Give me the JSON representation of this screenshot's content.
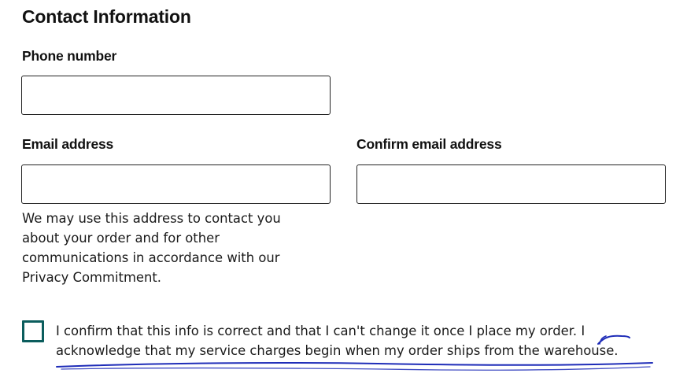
{
  "section": {
    "title": "Contact Information"
  },
  "phone": {
    "label": "Phone number",
    "value": ""
  },
  "email": {
    "label": "Email address",
    "value": "",
    "help_text": "We may use this address to contact you about your order and for other communications in accordance with our Privacy Commitment."
  },
  "confirm_email": {
    "label": "Confirm email address",
    "value": ""
  },
  "confirmation": {
    "checked": false,
    "text": "I confirm that this info is correct and that I can't change it once I place my order. I acknowledge that my service charges begin when my order ships from the warehouse."
  },
  "colors": {
    "checkbox_border": "#0b5d5d",
    "annotation_ink": "#1f2db8",
    "input_border": "#222222"
  }
}
